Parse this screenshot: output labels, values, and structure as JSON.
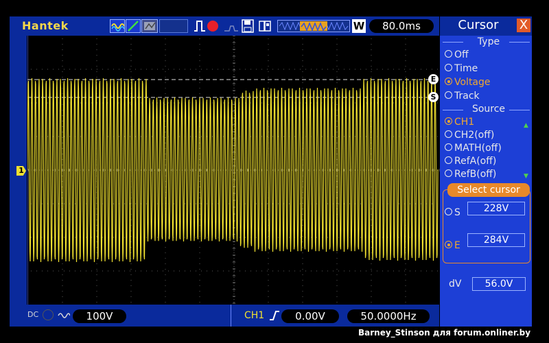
{
  "header": {
    "brand": "Hantek",
    "memory_mark": "W",
    "timebase": "80.0ms",
    "icons": [
      "waveform-icon",
      "slope-icon",
      "grey-icon",
      "pulse-icon",
      "record-icon",
      "run-icon",
      "disk-icon",
      "usb-icon"
    ]
  },
  "cursor_panel": {
    "title": "Cursor",
    "close": "X",
    "type_title": "Type",
    "type_options": [
      {
        "label": "Off",
        "selected": false
      },
      {
        "label": "Time",
        "selected": false
      },
      {
        "label": "Voltage",
        "selected": true
      },
      {
        "label": "Track",
        "selected": false
      }
    ],
    "source_title": "Source",
    "source_options": [
      {
        "label": "CH1",
        "selected": true
      },
      {
        "label": "CH2(off)",
        "selected": false
      },
      {
        "label": "MATH(off)",
        "selected": false
      },
      {
        "label": "RefA(off)",
        "selected": false
      },
      {
        "label": "RefB(off)",
        "selected": false
      }
    ],
    "select_cursor": "Select cursor",
    "s_label": "S",
    "s_value": "228V",
    "e_label": "E",
    "e_value": "284V",
    "dv_label": "dV",
    "dv_value": "56.0V"
  },
  "markers": {
    "ch1": "1",
    "cursor_e": "E",
    "cursor_s": "S"
  },
  "footer": {
    "coupling": "DC",
    "volts_div": "100V",
    "trigger_source": "CH1",
    "trigger_level": "0.00V",
    "frequency": "50.0000Hz"
  },
  "watermark": "Barney_Stinson для forum.onliner.by",
  "colors": {
    "trace": "#f0e030",
    "panel": "#1d3fd6",
    "header": "#0a2a9c",
    "accent": "#e8892a"
  }
}
